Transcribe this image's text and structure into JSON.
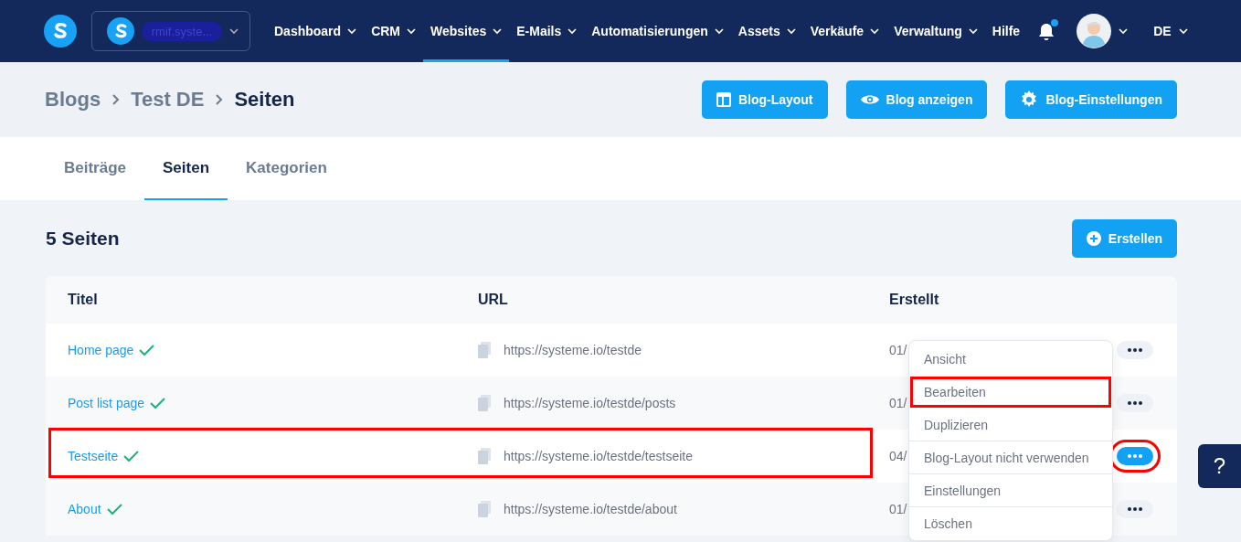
{
  "navbar": {
    "account": {
      "name": "rmif.syste..."
    },
    "items": [
      {
        "label": "Dashboard",
        "dropdown": true,
        "selected": false
      },
      {
        "label": "CRM",
        "dropdown": true,
        "selected": false
      },
      {
        "label": "Websites",
        "dropdown": true,
        "selected": true
      },
      {
        "label": "E-Mails",
        "dropdown": true,
        "selected": false
      },
      {
        "label": "Automatisierungen",
        "dropdown": true,
        "selected": false
      },
      {
        "label": "Assets",
        "dropdown": true,
        "selected": false
      },
      {
        "label": "Verkäufe",
        "dropdown": true,
        "selected": false
      },
      {
        "label": "Verwaltung",
        "dropdown": true,
        "selected": false
      },
      {
        "label": "Hilfe",
        "dropdown": false,
        "selected": false
      }
    ],
    "notifications_unread": true,
    "language": "DE"
  },
  "breadcrumb": [
    "Blogs",
    "Test DE",
    "Seiten"
  ],
  "header_buttons": [
    "Blog-Layout",
    "Blog anzeigen",
    "Blog-Einstellungen"
  ],
  "tabs": [
    {
      "label": "Beiträge",
      "selected": false
    },
    {
      "label": "Seiten",
      "selected": true
    },
    {
      "label": "Kategorien",
      "selected": false
    }
  ],
  "section": {
    "title": "5 Seiten",
    "create_button": "Erstellen"
  },
  "table": {
    "columns": [
      "Titel",
      "URL",
      "Erstellt"
    ],
    "rows": [
      {
        "title": "Home page",
        "published": true,
        "url": "https://systeme.io/testde",
        "created": "01/",
        "menu_open": false,
        "highlighted": false
      },
      {
        "title": "Post list page",
        "published": true,
        "url": "https://systeme.io/testde/posts",
        "created": "01/",
        "menu_open": false,
        "highlighted": false
      },
      {
        "title": "Testseite",
        "published": true,
        "url": "https://systeme.io/testde/testseite",
        "created": "04/",
        "menu_open": true,
        "highlighted": true
      },
      {
        "title": "About",
        "published": true,
        "url": "https://systeme.io/testde/about",
        "created": "01/",
        "menu_open": false,
        "highlighted": false
      }
    ]
  },
  "context_menu": {
    "items": [
      {
        "label": "Ansicht",
        "highlighted": false,
        "divider_after": false
      },
      {
        "label": "Bearbeiten",
        "highlighted": true,
        "divider_after": false
      },
      {
        "label": "Duplizieren",
        "highlighted": false,
        "divider_after": true
      },
      {
        "label": "Blog-Layout nicht verwenden",
        "highlighted": false,
        "divider_after": true
      },
      {
        "label": "Einstellungen",
        "highlighted": false,
        "divider_after": true
      },
      {
        "label": "Löschen",
        "highlighted": false,
        "divider_after": false
      }
    ]
  },
  "help_button": "?"
}
